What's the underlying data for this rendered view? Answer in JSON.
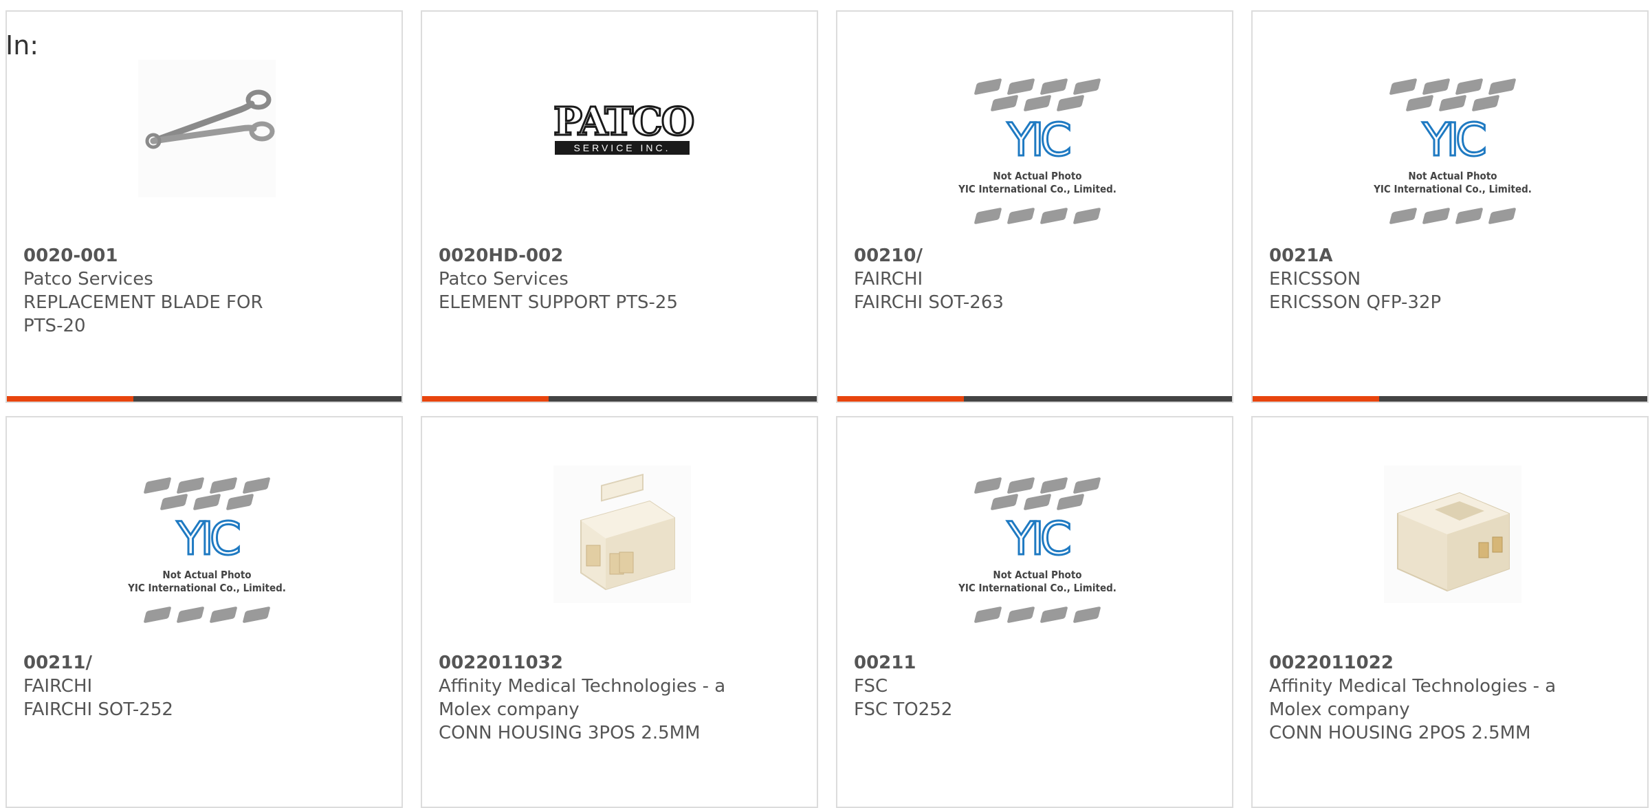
{
  "header": {
    "in_label": "In:"
  },
  "colors": {
    "accent": "#e8450e",
    "bar": "#444444",
    "border": "#dcdcdc",
    "text": "#555555",
    "logo_blue": "#1f7ac2"
  },
  "placeholder": {
    "logo": "YIC",
    "line1": "Not Actual Photo",
    "line2": "YIC International Co., Limited."
  },
  "patco_logo": {
    "top": "PATCO",
    "bottom": "SERVICE INC."
  },
  "products": [
    {
      "part": "0020-001",
      "maker": "Patco Services",
      "desc": "REPLACEMENT BLADE FOR PTS-20",
      "image": "scissors-blade"
    },
    {
      "part": "0020HD-002",
      "maker": "Patco Services",
      "desc": "ELEMENT SUPPORT PTS-25",
      "image": "patco-logo"
    },
    {
      "part": "00210/",
      "maker": "FAIRCHI",
      "desc": "FAIRCHI SOT-263",
      "image": "yic-placeholder"
    },
    {
      "part": "0021A",
      "maker": "ERICSSON",
      "desc": "ERICSSON QFP-32P",
      "image": "yic-placeholder"
    },
    {
      "part": "00211/",
      "maker": "FAIRCHI",
      "desc": "FAIRCHI SOT-252",
      "image": "yic-placeholder"
    },
    {
      "part": "0022011032",
      "maker": "Affinity Medical Technologies - a Molex company",
      "desc": "CONN HOUSING 3POS 2.5MM",
      "image": "connector-3pos"
    },
    {
      "part": "00211",
      "maker": "FSC",
      "desc": "FSC TO252",
      "image": "yic-placeholder"
    },
    {
      "part": "0022011022",
      "maker": "Affinity Medical Technologies - a Molex company",
      "desc": "CONN HOUSING 2POS 2.5MM",
      "image": "connector-2pos"
    }
  ]
}
